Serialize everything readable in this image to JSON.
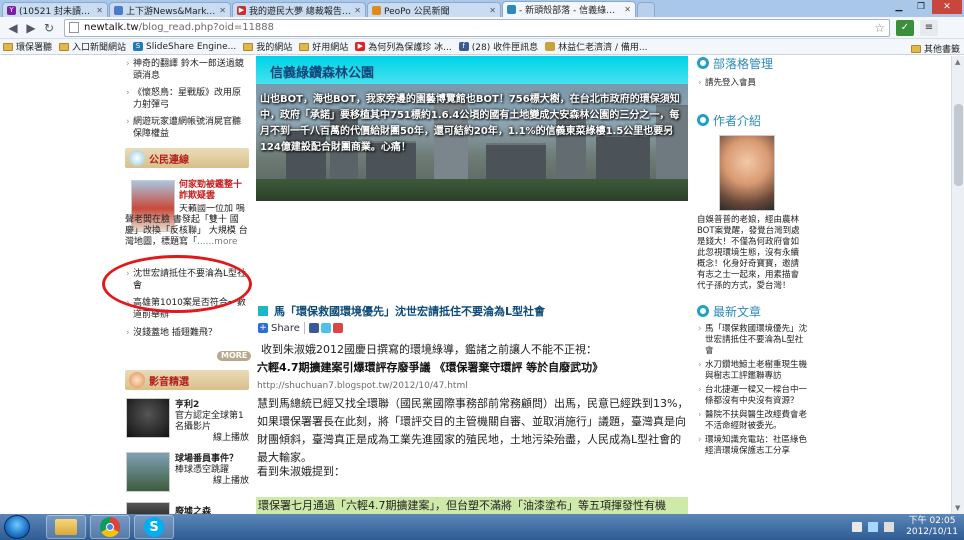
{
  "browser": {
    "tabs": [
      {
        "title": "(10521 封未讀取) - tchan",
        "favicon_color": "#7b1fa2"
      },
      {
        "title": "上下游News&Market新聞",
        "favicon_color": "#4a7cc7"
      },
      {
        "title": "我的遊民大夢 總裁報告 觀",
        "favicon_color": "#c9302c"
      },
      {
        "title": "PeoPo 公民新聞",
        "favicon_color": "#e08a1e"
      },
      {
        "title": "- 新頭殼部落 - 信義綠鑽森",
        "favicon_color": "#2b8ab9"
      }
    ],
    "url_host": "newtalk.tw",
    "url_path": "/blog_read.php?oid=11888",
    "bookmarks": [
      {
        "label": "環保署聽",
        "icon": "folder-icon"
      },
      {
        "label": "入口新聞網站",
        "icon": "folder-icon"
      },
      {
        "label": "SlideShare Engine...",
        "icon": "slideshare-icon"
      },
      {
        "label": "我的網站",
        "icon": "folder-icon"
      },
      {
        "label": "好用網站",
        "icon": "folder-icon"
      },
      {
        "label": "為何列為保護珍 冰...",
        "icon": "youtube-icon"
      },
      {
        "label": "(28) 收件匣訊息",
        "icon": "facebook-icon"
      },
      {
        "label": "林益仁老濟濟 / 備用...",
        "icon": "bookmark-icon"
      }
    ],
    "other_bookmarks": "其他書籤"
  },
  "left": {
    "top_items": [
      "神奇的翻譯 鈴木一郎送過鏡頭消息",
      "《懷怒鳥：星戰版》改用原力射彈弓",
      "網遊玩家遭網帳號消屍官聽 保障權益"
    ],
    "citizen_head": "公民連線",
    "citizen_feature": {
      "title": "何家勁被鑑整十詐欺疑雲",
      "body": "天籟國一位加 嗚聲老闆在臉 書發起「雙十 國慶」改換「反核聯」 大規模 台灣地圖，標題寫「",
      "more": "......more"
    },
    "citizen_items": [
      "沈世宏請抵住不要淪為L型社會",
      "高雄第1010案是否符合一數道前舉辦",
      "沒錢蓋地 插翅難飛？"
    ],
    "more_btn": "MORE",
    "video_head": "影音精選",
    "videos": [
      {
        "title": "亨利2",
        "desc": "官方認定全球第1名攝影片",
        "action": "線上播放"
      },
      {
        "title": "球場番員事件？",
        "desc": "棒球憑空跳躍",
        "action": "線上播放"
      },
      {
        "title": "廢墟之森",
        "desc": "",
        "action": ""
      }
    ]
  },
  "hero": {
    "title": "信義綠鑽森林公園",
    "text": "山也BOT，海也BOT，我家旁邊的園藝博覽館也BOT！756標大樹，在台北市政府的環保須知中，政府「承諾」要移植其中751標約1.6.4公頃的國有土地變成大安森林公園的三分之一，每月不到一千八百萬的代價給財團50年，還可結約20年，1.1%的信義東菜綠樓1.5公里也要另124億建設配合財團商業。心痛！"
  },
  "article": {
    "headline": "馬「環保救國環境優先」沈世宏請抵住不要淪為L型社會",
    "share": "Share",
    "p1": "收到朱淑娥2012國慶日撰寫的環境綠導，鑑諸之前讓人不能不正視：",
    "bold_title": "六輕4.7期擴建案引爆環評存廢爭議 《環保署棄守環評 等於自廢武功》",
    "link": "http://shuchuan7.blogspot.tw/2012/10/47.html",
    "p2": "慧到馬總統已經又找全環聯（國民黨國際事務部前常務顧問）出馬，民意已經跌到13%，如果環保署署長在此刻，將「環評交目的主管機關自審、並取消施行」議題，臺灣真是向財團傾斜，臺灣真正是成為工業先進國家的殖民地，土地污染殆盡，人民成為L型社會的最大輸家。",
    "p3": "看到朱淑娥提到：",
    "highlight": "環保署七月通過「六輕4.7期擴建案」，但台塑不滿將「油漆塗布」等五項揮發性有機"
  },
  "right": {
    "blog_head": "部落格管理",
    "login": "請先登入會員",
    "author_head": "作者介紹",
    "author_bio": "自娛普普的老娘，經由農林BOT案覺醒，發覺台灣到處是錢大！不僅為何政府會如此忽視環境生態，沒有永續概念！化身好奇寶寶，邀請有志之士一起來，用素描會代子孫的方式，愛台灣！",
    "latest_head": "最新文章",
    "latest": [
      "馬「環保救國環境優先」沈世宏請抵住不要淪為L型社會",
      "水刀鑽地鯨土老樹重現生機與樹志工評鑑聯專訪",
      "台北捷運一樑又一樑台中一條都沒有中央沒有資源？",
      "醫院不扶與醫生改經費會老不活命經財被委光。",
      "環境知識充電站：社區綠色經濟環境保護志工分享"
    ]
  },
  "taskbar": {
    "time": "下午 02:05",
    "date": "2012/10/11"
  },
  "colors": {
    "accent_teal": "#1fb5c2",
    "link_blue": "#2b8ab9",
    "annotation_red": "#e0191d"
  }
}
